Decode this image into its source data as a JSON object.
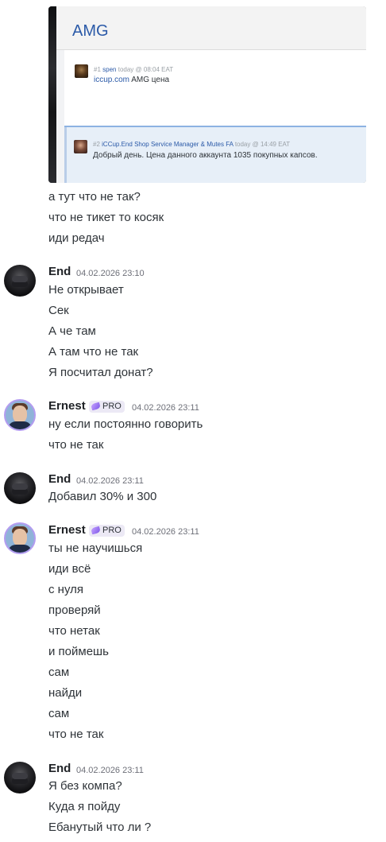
{
  "embed": {
    "title": "AMG",
    "post1": {
      "num": "#1",
      "author": "spen",
      "time": "today @ 08:04 EAT",
      "link": "iccup.com",
      "text": " AMG цена"
    },
    "post2": {
      "num": "#2",
      "author": "iCCup.End",
      "role": "Shop Service Manager & Mutes FA",
      "time": "today @ 14:49 EAT",
      "text": "Добрый день. Цена данного аккаунта 1035 покупных капсов."
    }
  },
  "continued_lines": [
    "а тут что не так?",
    "что не тикет то косяк",
    "иди редач"
  ],
  "messages": [
    {
      "user": "End",
      "time": "04.02.2026 23:10",
      "lines": [
        "Не открывает",
        "Сек",
        "А че там",
        "А там что не так",
        "Я посчитал донат?"
      ]
    },
    {
      "user": "Ernest",
      "badge": "PRO",
      "time": "04.02.2026 23:11",
      "lines": [
        "ну если постоянно говорить",
        "что не так"
      ]
    },
    {
      "user": "End",
      "time": "04.02.2026 23:11",
      "lines": [
        "Добавил 30% и 300"
      ]
    },
    {
      "user": "Ernest",
      "badge": "PRO",
      "time": "04.02.2026 23:11",
      "lines": [
        "ты не научишься",
        "иди всё",
        "с нуля",
        "проверяй",
        "что нетак",
        "и поймешь",
        "сам",
        "найди",
        "сам",
        "что не так"
      ]
    },
    {
      "user": "End",
      "time": "04.02.2026 23:11",
      "lines": [
        "Я без компа?",
        "Куда я пойду",
        "Ебанутый что ли ?"
      ]
    }
  ]
}
